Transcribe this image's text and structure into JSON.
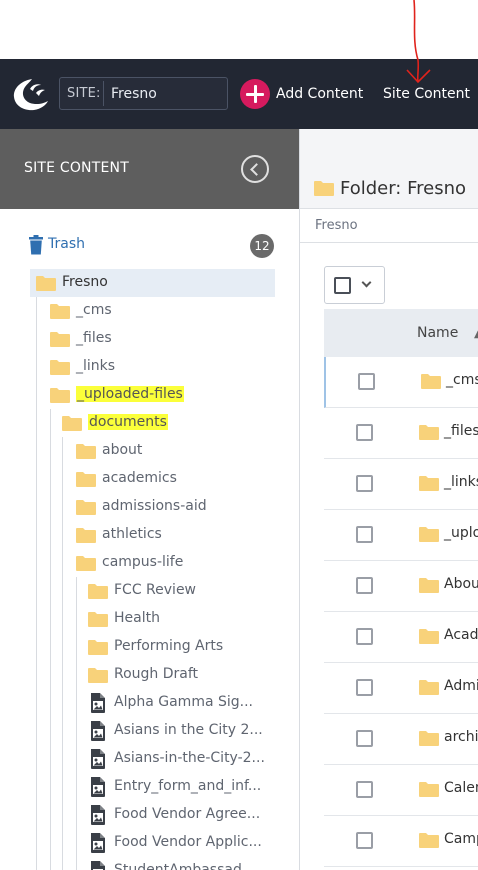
{
  "topbar": {
    "site_label": "SITE:",
    "site_value": "Fresno",
    "add_content_label": "Add Content",
    "site_content_label": "Site Content"
  },
  "sidebar": {
    "title": "SITE CONTENT",
    "trash_label": "Trash",
    "trash_count": "12",
    "tree": [
      {
        "label": "Fresno",
        "type": "folder",
        "level": 0,
        "selected": true
      },
      {
        "label": "_cms",
        "type": "folder",
        "level": 1
      },
      {
        "label": "_files",
        "type": "folder",
        "level": 1
      },
      {
        "label": "_links",
        "type": "folder",
        "level": 1
      },
      {
        "label": "_uploaded-files",
        "type": "folder",
        "level": 1,
        "highlight": true
      },
      {
        "label": "documents",
        "type": "folder",
        "level": 2,
        "highlight": true
      },
      {
        "label": "about",
        "type": "folder",
        "level": 3
      },
      {
        "label": "academics",
        "type": "folder",
        "level": 3
      },
      {
        "label": "admissions-aid",
        "type": "folder",
        "level": 3
      },
      {
        "label": "athletics",
        "type": "folder",
        "level": 3
      },
      {
        "label": "campus-life",
        "type": "folder",
        "level": 3
      },
      {
        "label": "FCC Review",
        "type": "folder",
        "level": 4
      },
      {
        "label": "Health",
        "type": "folder",
        "level": 4
      },
      {
        "label": "Performing Arts",
        "type": "folder",
        "level": 4
      },
      {
        "label": "Rough Draft",
        "type": "folder",
        "level": 4
      },
      {
        "label": "Alpha Gamma Sig...",
        "type": "file",
        "level": 4
      },
      {
        "label": "Asians in the City 2...",
        "type": "file",
        "level": 4
      },
      {
        "label": "Asians-in-the-City-2...",
        "type": "file",
        "level": 4
      },
      {
        "label": "Entry_form_and_inf...",
        "type": "file",
        "level": 4
      },
      {
        "label": "Food Vendor Agree...",
        "type": "file",
        "level": 4
      },
      {
        "label": "Food Vendor Applic...",
        "type": "file",
        "level": 4
      },
      {
        "label": "StudentAmbassad...",
        "type": "file",
        "level": 4
      }
    ]
  },
  "main": {
    "title": "Folder: Fresno",
    "breadcrumb": "Fresno",
    "column_name": "Name",
    "rows": [
      "_cms",
      "_files",
      "_links",
      "_uploaded-files",
      "About",
      "Academics",
      "Admissions",
      "archive",
      "Calendar",
      "Campus Life"
    ]
  },
  "colors": {
    "navbar": "#222733",
    "add_button": "#d61a5e",
    "sidebar_header": "#5e5e5e",
    "folder": "#f8d27a",
    "highlight": "#fbff3a",
    "annotation": "#e0231c"
  },
  "icons": {
    "logo": "cascade-logo-icon",
    "add": "plus-circle-icon",
    "collapse": "chevron-left-circle-icon",
    "trash": "trash-icon",
    "folder": "folder-icon",
    "file": "image-file-icon",
    "dropdown": "chevron-down-icon"
  }
}
